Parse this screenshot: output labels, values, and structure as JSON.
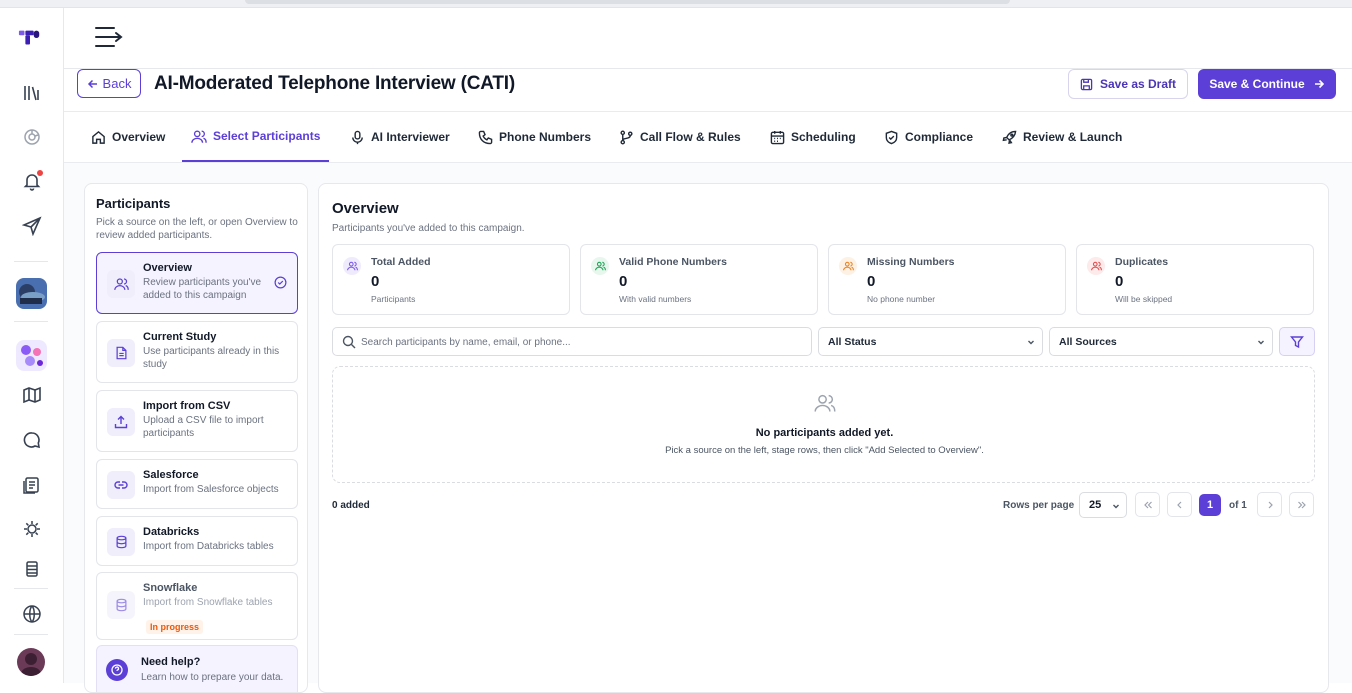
{
  "header": {
    "back_label": "Back",
    "title": "AI-Moderated Telephone Interview (CATI)",
    "save_draft_label": "Save as Draft",
    "save_continue_label": "Save & Continue"
  },
  "tabs": [
    {
      "label": "Overview",
      "icon": "home-icon"
    },
    {
      "label": "Select Participants",
      "icon": "users-icon",
      "active": true
    },
    {
      "label": "AI Interviewer",
      "icon": "microphone-icon"
    },
    {
      "label": "Phone Numbers",
      "icon": "phone-icon"
    },
    {
      "label": "Call Flow & Rules",
      "icon": "git-branch-icon"
    },
    {
      "label": "Scheduling",
      "icon": "calendar-icon"
    },
    {
      "label": "Compliance",
      "icon": "shield-check-icon"
    },
    {
      "label": "Review & Launch",
      "icon": "rocket-icon"
    }
  ],
  "participants_panel": {
    "title": "Participants",
    "subtitle": "Pick a source on the left, or open Overview to review added participants.",
    "sources": [
      {
        "title": "Overview",
        "desc": "Review participants you've added to this campaign",
        "icon": "users-icon",
        "active": true
      },
      {
        "title": "Current Study",
        "desc": "Use participants already in this study",
        "icon": "document-icon"
      },
      {
        "title": "Import from CSV",
        "desc": "Upload a CSV file to import participants",
        "icon": "upload-icon"
      },
      {
        "title": "Salesforce",
        "desc": "Import from Salesforce objects",
        "icon": "link-icon"
      },
      {
        "title": "Databricks",
        "desc": "Import from Databricks tables",
        "icon": "database-icon"
      },
      {
        "title": "Snowflake",
        "desc": "Import from Snowflake tables",
        "icon": "database-icon",
        "badge": "In progress"
      }
    ],
    "help_title": "Need help?",
    "help_desc": "Learn how to prepare your data."
  },
  "overview": {
    "title": "Overview",
    "subtitle": "Participants you've added to this campaign.",
    "stats": [
      {
        "label": "Total Added",
        "value": "0",
        "caption": "Participants",
        "color": "#7c5ce6"
      },
      {
        "label": "Valid Phone Numbers",
        "value": "0",
        "caption": "With valid numbers",
        "color": "#22a559"
      },
      {
        "label": "Missing Numbers",
        "value": "0",
        "caption": "No phone number",
        "color": "#e8862a"
      },
      {
        "label": "Duplicates",
        "value": "0",
        "caption": "Will be skipped",
        "color": "#e05252"
      }
    ],
    "search_placeholder": "Search participants by name, email, or phone...",
    "status_filter": "All Status",
    "source_filter": "All Sources",
    "empty_title": "No participants added yet.",
    "empty_desc": "Pick a source on the left, stage rows, then click \"Add Selected to Overview\".",
    "added_count": "0 added",
    "rows_per_page_label": "Rows per page",
    "rows_per_page": "25",
    "current_page": "1",
    "page_of": "of 1"
  },
  "colors": {
    "accent": "#5b3fd6"
  }
}
